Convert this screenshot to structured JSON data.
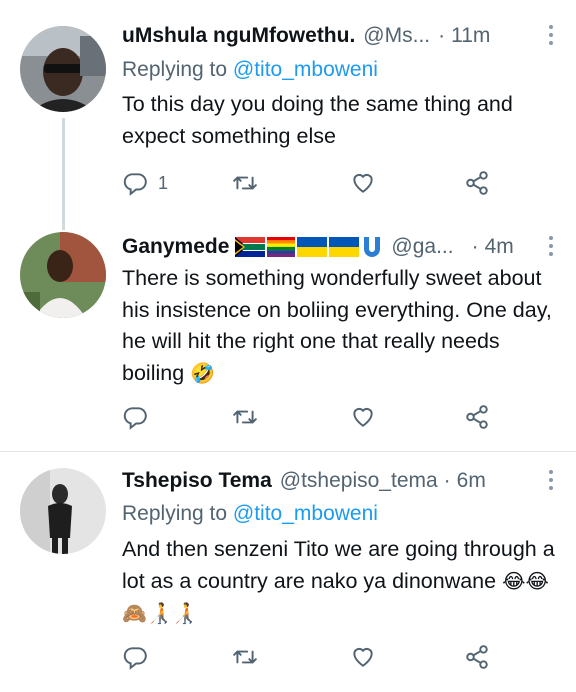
{
  "tweets": [
    {
      "name": "uMshula nguMfowethu.",
      "handle": "@Ms...",
      "dot": "·",
      "time": "11m",
      "replying_prefix": "Replying to",
      "replying_to": "@tito_mboweni",
      "text": "To this day you doing the same thing and expect something else",
      "reply_count": "1"
    },
    {
      "name": "Ganymede",
      "handle": "@ga...",
      "dot": "·",
      "time": "4m",
      "text_main": "There is something wonderfully sweet about his insistence on boliing everything.  One day, he will hit the right one that really needs boiling",
      "emoji_end": "🤣"
    },
    {
      "name": "Tshepiso Tema",
      "handle": "@tshepiso_tema",
      "dot": "·",
      "time": "6m",
      "replying_prefix": "Replying to",
      "replying_to": "@tito_mboweni",
      "text_main": "And then senzeni Tito we are going through a lot as a country are nako ya dinonwane",
      "emoji_end": "😂😂🙈🧑‍🦯🧑‍🦯"
    }
  ],
  "colors": {
    "link": "#1d9bf0",
    "secondary": "#536471",
    "thread_line": "#cfd9de"
  }
}
